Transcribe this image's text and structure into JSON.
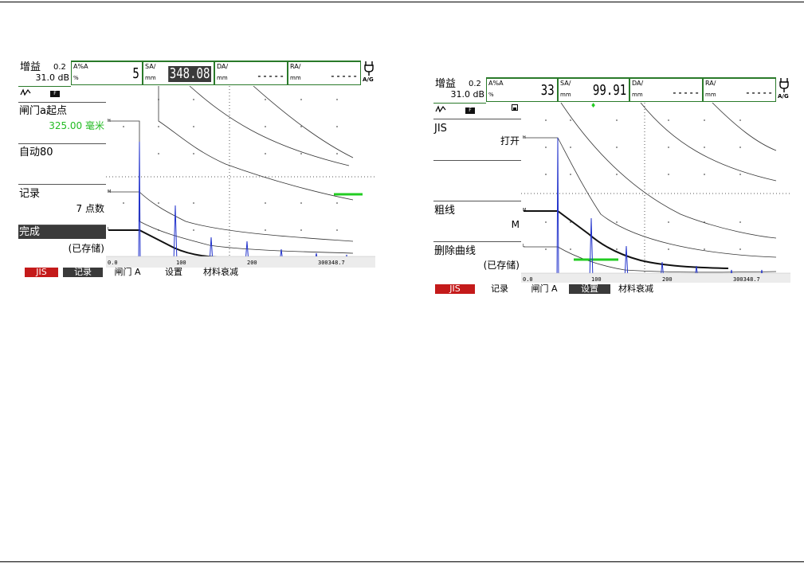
{
  "left": {
    "gain": {
      "label": "增益",
      "step": "0.2",
      "value": "31.0 dB"
    },
    "measurements": [
      {
        "name": "A%A",
        "unit": "%",
        "value": "5",
        "highlight": false
      },
      {
        "name": "SA/",
        "unit": "mm",
        "value": "348.08",
        "highlight": true
      },
      {
        "name": "DA/",
        "unit": "mm",
        "value": "-----",
        "highlight": false
      },
      {
        "name": "RA/",
        "unit": "mm",
        "value": "-----",
        "highlight": false
      }
    ],
    "mode_badge": "A/G",
    "menu": [
      {
        "label": "闸门a起点",
        "value": "325.00 毫米",
        "value_color": "green",
        "selected": false
      },
      {
        "label": "自动80",
        "value": "",
        "selected": false
      },
      {
        "label": "记录",
        "value": "7 点数",
        "selected": false
      },
      {
        "label": "完成",
        "value": "(已存储)",
        "selected": true
      }
    ],
    "axis": {
      "start": "0.0",
      "mid1": "100",
      "mid2": "200",
      "readout": "300348.7"
    },
    "tabs": [
      {
        "label": "JIS",
        "style": "red"
      },
      {
        "label": "记录",
        "style": "dark"
      },
      {
        "label": "闸门 A",
        "style": "plain"
      },
      {
        "label": "设置",
        "style": "plain"
      },
      {
        "label": "材料衰减",
        "style": "plain"
      }
    ]
  },
  "right": {
    "gain": {
      "label": "增益",
      "step": "0.2",
      "value": "31.0 dB"
    },
    "measurements": [
      {
        "name": "A%A",
        "unit": "%",
        "value": "33",
        "highlight": false
      },
      {
        "name": "SA/",
        "unit": "mm",
        "value": "99.91",
        "highlight": false
      },
      {
        "name": "DA/",
        "unit": "mm",
        "value": "-----",
        "highlight": false
      },
      {
        "name": "RA/",
        "unit": "mm",
        "value": "-----",
        "highlight": false
      }
    ],
    "mode_badge": "A/G",
    "menu": [
      {
        "label": "JIS",
        "value": "打开",
        "selected": false
      },
      {
        "label": "",
        "value": "",
        "selected": false
      },
      {
        "label": "粗线",
        "value": "M",
        "selected": false
      },
      {
        "label": "删除曲线",
        "value": "(已存储)",
        "selected": false
      }
    ],
    "axis": {
      "start": "0.0",
      "mid1": "100",
      "mid2": "200",
      "readout": "300348.7"
    },
    "tabs": [
      {
        "label": "JIS",
        "style": "red"
      },
      {
        "label": "记录",
        "style": "plain"
      },
      {
        "label": "闸门 A",
        "style": "plain"
      },
      {
        "label": "设置",
        "style": "dark"
      },
      {
        "label": "材料衰减",
        "style": "plain"
      }
    ]
  },
  "colors": {
    "frame_green": "#2a7a2a",
    "gate_green": "#22cc22",
    "echo_blue": "#2233cc",
    "tab_red": "#c41a1a",
    "selected_dark": "#3a3a3a"
  }
}
